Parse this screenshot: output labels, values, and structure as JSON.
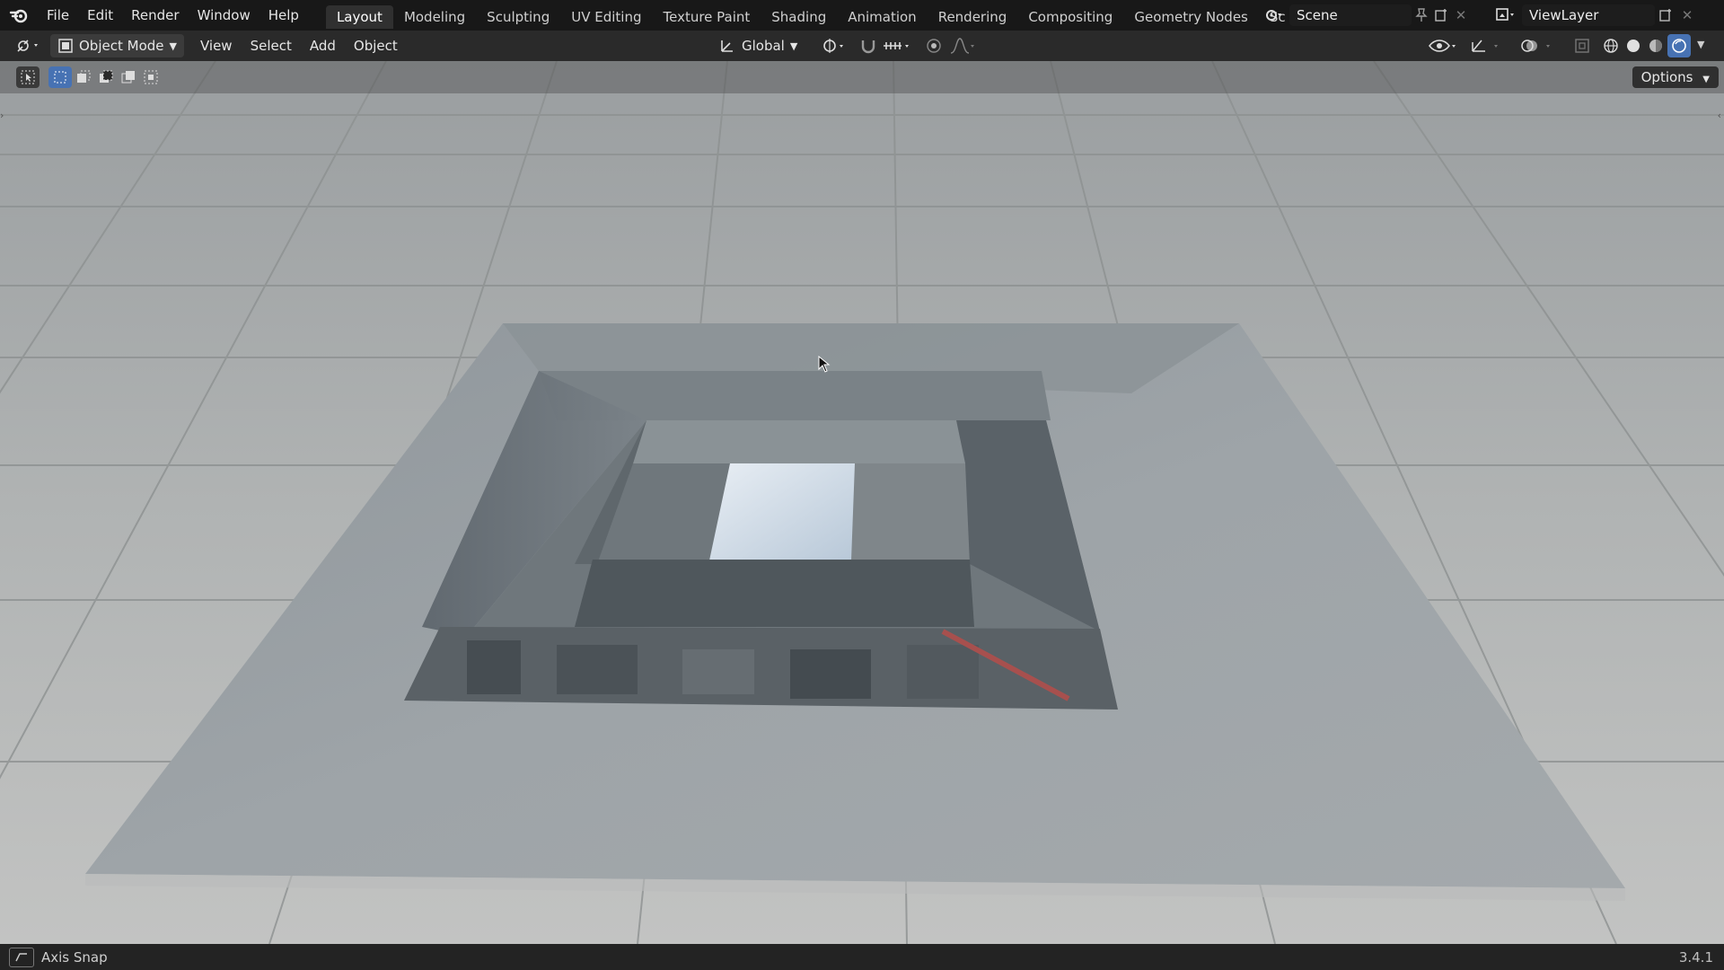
{
  "menu": {
    "file": "File",
    "edit": "Edit",
    "render": "Render",
    "window": "Window",
    "help": "Help"
  },
  "workspaces": [
    "Layout",
    "Modeling",
    "Sculpting",
    "UV Editing",
    "Texture Paint",
    "Shading",
    "Animation",
    "Rendering",
    "Compositing",
    "Geometry Nodes",
    "Sc"
  ],
  "active_workspace": "Layout",
  "scene": {
    "name": "Scene"
  },
  "view_layer": {
    "name": "ViewLayer"
  },
  "header": {
    "mode": "Object Mode",
    "view": "View",
    "select": "Select",
    "add": "Add",
    "object": "Object",
    "transform_orientation": "Global"
  },
  "tool_settings": {
    "options": "Options"
  },
  "status": {
    "left": "Axis Snap",
    "version": "3.4.1"
  },
  "colors": {
    "accent": "#4772b3",
    "header_bg": "#181818",
    "toolbar_bg": "#2a2a2a"
  }
}
